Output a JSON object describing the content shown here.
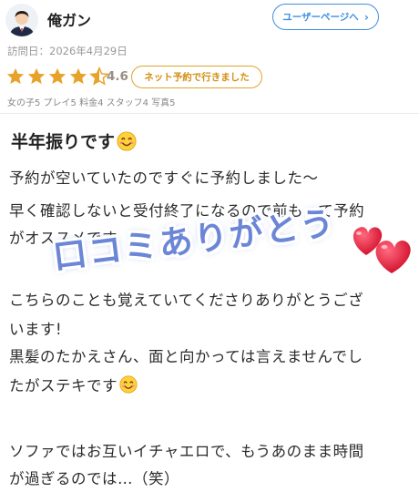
{
  "user": {
    "name": "俺ガン",
    "user_page_label": "ユーザーページへ",
    "chevron": "›"
  },
  "visit": {
    "date_text": "訪問日：2026年4月29日"
  },
  "rating": {
    "value": "4.6",
    "stars": 4.6,
    "badge": "ネット予約で行きました"
  },
  "scores_text": "女の子5 プレイ5 料金4 スタッフ4 写真5",
  "review": {
    "title": "半年振りです",
    "lines": [
      "予約が空いていたのですぐに予約しました〜",
      "早く確認しないと受付終了になるので前もって予約",
      "がオススメです",
      "こちらのことも覚えていてくださりありがとうござ",
      "います!",
      "黒髪のたかえさん、面と向かっては言えませんでし",
      "たがステキです",
      "ソファではお互いイチャエロで、もうあのまま時間",
      "が過ぎるのでは…（笑）"
    ]
  },
  "overlay": {
    "text": "口コミありがとう"
  },
  "colors": {
    "accent_blue": "#3f8fe0",
    "badge_orange": "#e0a52a",
    "star": "#e7a329",
    "overlay": "#6b86d6",
    "heart": "#e8243f"
  },
  "icons": {
    "avatar": "avatar-icon",
    "star": "star-icon",
    "emoji": "smile-emoji-icon",
    "heart": "heart-icon"
  }
}
